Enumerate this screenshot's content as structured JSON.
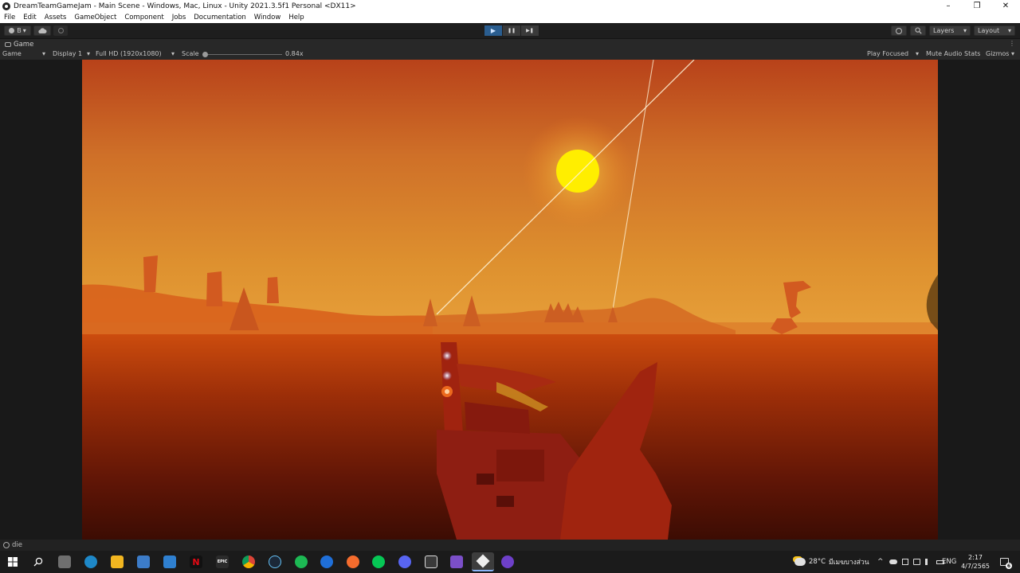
{
  "window": {
    "title": "DreamTeamGameJam - Main Scene - Windows, Mac, Linux - Unity 2021.3.5f1 Personal <DX11>",
    "minimize": "–",
    "maximize": "❐",
    "close": "✕"
  },
  "menu": [
    "File",
    "Edit",
    "Assets",
    "GameObject",
    "Component",
    "Jobs",
    "Documentation",
    "Window",
    "Help"
  ],
  "toolbar": {
    "account_label": "B",
    "layers_label": "Layers",
    "layout_label": "Layout",
    "play_symbol": "▶",
    "pause_symbol": "❚❚",
    "step_symbol": "▶❚",
    "dropdown_arrow": "▾",
    "more_symbol": "⋮"
  },
  "tab": {
    "label": "Game"
  },
  "game_toolbar": {
    "mode": "Game",
    "display": "Display 1",
    "resolution": "Full HD (1920x1080)",
    "scale_label": "Scale",
    "scale_value": "0.84x",
    "scale_fraction": 0.03,
    "play_focused": "Play Focused",
    "mute_audio": "Mute Audio",
    "stats": "Stats",
    "gizmos": "Gizmos"
  },
  "status": {
    "message": "die"
  },
  "taskbar": {
    "icons": [
      "windows-start-icon",
      "search-icon",
      "cortana-icon",
      "edge-icon",
      "file-explorer-icon",
      "store-icon",
      "mail-icon",
      "netflix-icon",
      "epic-games-icon",
      "chrome-icon",
      "steam-icon",
      "spotify-icon",
      "app-icon",
      "origin-icon",
      "line-icon",
      "discord-icon",
      "unity-hub-icon",
      "visual-studio-icon",
      "unity-icon",
      "github-icon"
    ],
    "netflix_letter": "N",
    "epic_text": "EPIC",
    "weather_temp": "28°C",
    "weather_desc": "มีเมฆบางส่วน",
    "language": "ENG",
    "time": "2:17",
    "date": "4/7/2565",
    "notification_count": "6",
    "tray_chevron": "^"
  },
  "colors": {
    "sky_top": "#c14a1a",
    "sky_mid": "#d8822c",
    "horizon": "#e59a35",
    "sea_top": "#c84a10",
    "sea_bottom": "#3e0d04",
    "sun": "#ffee00",
    "boat": "#8e1e12",
    "play_active": "#2a5d8f"
  }
}
